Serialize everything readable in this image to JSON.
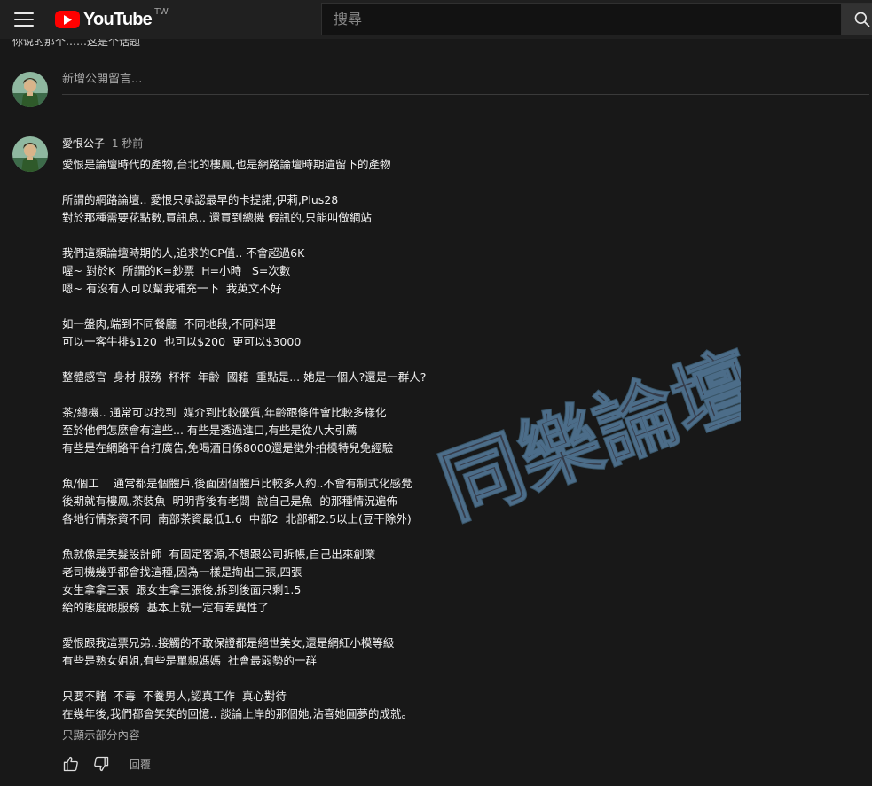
{
  "header": {
    "logo_text": "YouTube",
    "region": "TW",
    "search_placeholder": "搜尋"
  },
  "top_cut_text": "你说的那个……这是个话题",
  "add_comment": {
    "placeholder": "新增公開留言..."
  },
  "comment": {
    "author": "愛恨公子",
    "time": "1 秒前",
    "body": "愛恨是論壇時代的產物,台北的樓鳳,也是網路論壇時期遺留下的產物\n\n所謂的網路論壇.. 愛恨只承認最早的卡提諾,伊莉,Plus28\n對於那種需要花點數,買訊息.. 還買到總機 假訊的,只能叫做網站\n\n我們這類論壇時期的人,追求的CP值.. 不會超過6K\n喔~ 對於K  所謂的K=鈔票  H=小時   S=次數\n嗯~ 有沒有人可以幫我補充一下  我英文不好\n\n如一盤肉,端到不同餐廳  不同地段,不同料理\n可以一客牛排$120  也可以$200  更可以$3000\n\n整體感官  身材 服務  杯杯  年齡  國籍  重點是... 她是一個人?還是一群人?\n\n茶/總機.. 通常可以找到  媒介到比較優質,年齡跟條件會比較多樣化\n至於他們怎麼會有這些... 有些是透過進口,有些是從八大引薦\n有些是在網路平台打廣告,免喝酒日係8000還是徵外拍模特兒免經驗\n\n魚/個工    通常都是個體戶,後面因個體戶比較多人約..不會有制式化感覺\n後期就有樓鳳,茶裝魚  明明背後有老闆  說自己是魚  的那種情況遍佈\n各地行情茶資不同  南部茶資最低1.6  中部2  北部都2.5以上(豆干除外)\n\n魚就像是美髮設計師  有固定客源,不想跟公司拆帳,自己出來創業\n老司機幾乎都會找這種,因為一樣是掏出三張,四張\n女生拿拿三張  跟女生拿三張後,拆到後面只剩1.5\n給的態度跟服務  基本上就一定有差異性了\n\n愛恨跟我這票兄弟..接觸的不敢保證都是絕世美女,還是網紅小模等級\n有些是熟女姐姐,有些是單親媽媽  社會最弱勢的一群\n\n只要不賭  不毒  不養男人,認真工作  真心對待\n在幾年後,我們都會笑笑的回憶.. 談論上岸的那個她,沾喜她圓夢的成就。",
    "show_less": "只顯示部分內容",
    "reply": "回覆"
  },
  "watermark": {
    "text": "同樂論壇"
  },
  "colors": {
    "background": "#181818",
    "topbar": "#202020",
    "brand_red": "#ff0000",
    "text_primary": "#f1f1f1",
    "text_secondary": "#aaaaaa"
  },
  "icons": [
    "menu-icon",
    "youtube-logo-icon",
    "search-icon",
    "like-icon",
    "dislike-icon"
  ]
}
